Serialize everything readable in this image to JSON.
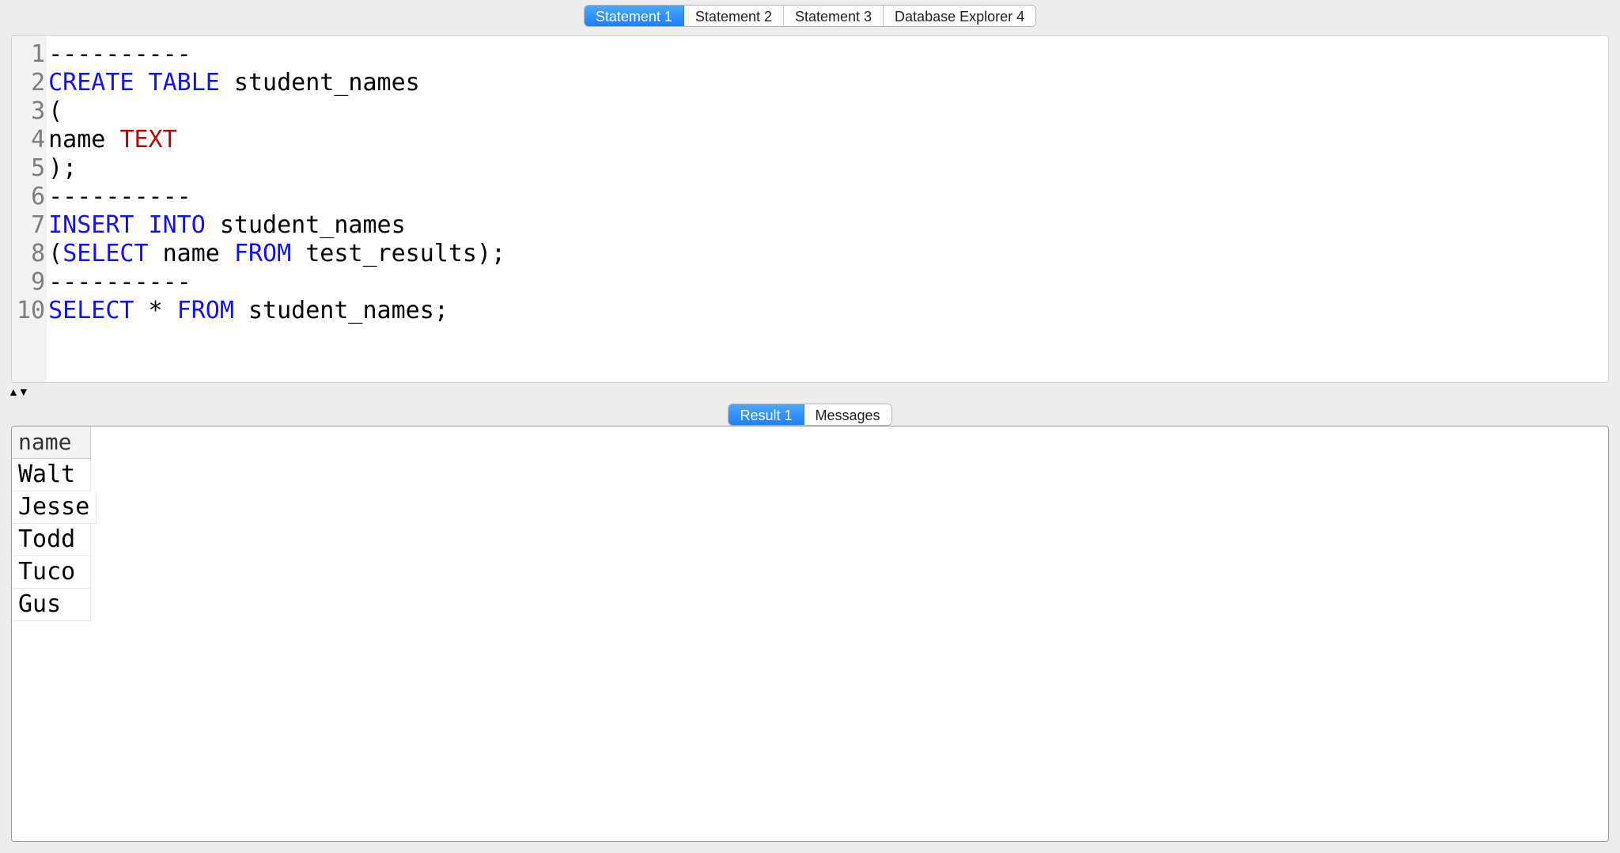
{
  "tabs": {
    "top": [
      {
        "label": "Statement 1",
        "active": true
      },
      {
        "label": "Statement 2",
        "active": false
      },
      {
        "label": "Statement 3",
        "active": false
      },
      {
        "label": "Database Explorer 4",
        "active": false
      }
    ],
    "bottom": [
      {
        "label": "Result 1",
        "active": true
      },
      {
        "label": "Messages",
        "active": false
      }
    ]
  },
  "editor": {
    "lines": [
      {
        "n": 1,
        "tokens": [
          {
            "t": "----------",
            "c": "ident"
          }
        ]
      },
      {
        "n": 2,
        "tokens": [
          {
            "t": "CREATE TABLE",
            "c": "kw"
          },
          {
            "t": " student_names",
            "c": "ident"
          }
        ]
      },
      {
        "n": 3,
        "tokens": [
          {
            "t": "(",
            "c": "punc"
          }
        ]
      },
      {
        "n": 4,
        "tokens": [
          {
            "t": "name ",
            "c": "ident"
          },
          {
            "t": "TEXT",
            "c": "type"
          }
        ]
      },
      {
        "n": 5,
        "tokens": [
          {
            "t": ");",
            "c": "punc"
          }
        ]
      },
      {
        "n": 6,
        "tokens": [
          {
            "t": "----------",
            "c": "ident"
          }
        ]
      },
      {
        "n": 7,
        "tokens": [
          {
            "t": "INSERT INTO",
            "c": "kw"
          },
          {
            "t": " student_names",
            "c": "ident"
          }
        ]
      },
      {
        "n": 8,
        "tokens": [
          {
            "t": "(",
            "c": "punc"
          },
          {
            "t": "SELECT",
            "c": "kw"
          },
          {
            "t": " name ",
            "c": "ident"
          },
          {
            "t": "FROM",
            "c": "kw"
          },
          {
            "t": " test_results",
            "c": "ident"
          },
          {
            "t": ");",
            "c": "punc"
          }
        ]
      },
      {
        "n": 9,
        "tokens": [
          {
            "t": "----------",
            "c": "ident"
          }
        ]
      },
      {
        "n": 10,
        "tokens": [
          {
            "t": "SELECT",
            "c": "kw"
          },
          {
            "t": " * ",
            "c": "ident"
          },
          {
            "t": "FROM",
            "c": "kw"
          },
          {
            "t": " student_names",
            "c": "ident"
          },
          {
            "t": ";",
            "c": "punc"
          }
        ]
      }
    ]
  },
  "result": {
    "columns": [
      "name"
    ],
    "rows": [
      [
        "Walt"
      ],
      [
        "Jesse"
      ],
      [
        "Todd"
      ],
      [
        "Tuco"
      ],
      [
        "Gus"
      ]
    ]
  }
}
